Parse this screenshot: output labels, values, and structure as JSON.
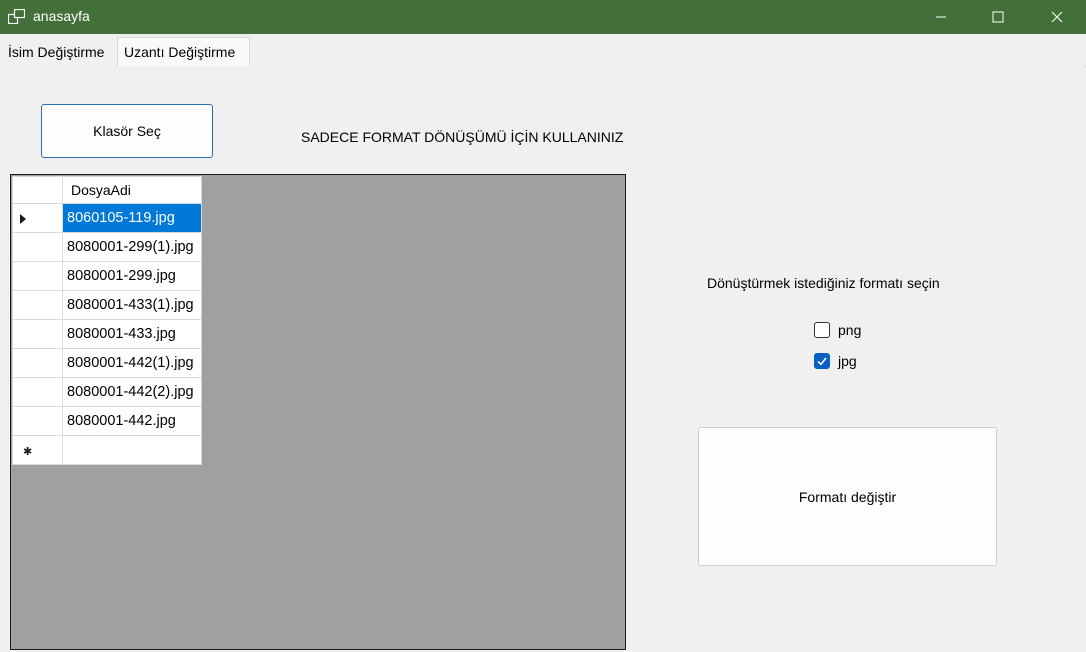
{
  "window": {
    "title": "anasayfa",
    "icon": "app-windows-icon",
    "controls": [
      "minimize-icon",
      "maximize-icon",
      "close-icon"
    ],
    "titlebar_color": "#437039"
  },
  "tabs": [
    {
      "label": "İsim Değiştirme",
      "active": false
    },
    {
      "label": "Uzantı Değiştirme",
      "active": true
    }
  ],
  "main": {
    "folder_button_label": "Klasör Seç",
    "notice": "SADECE FORMAT DÖNÜŞÜMÜ İÇİN KULLANINIZ",
    "grid": {
      "column_header": "DosyaAdi",
      "rows": [
        "8060105-119.jpg",
        "8080001-299(1).jpg",
        "8080001-299.jpg",
        "8080001-433(1).jpg",
        "8080001-433.jpg",
        "8080001-442(1).jpg",
        "8080001-442(2).jpg",
        "8080001-442.jpg"
      ],
      "selected_row": 0,
      "selection_color": "#0078d7"
    },
    "format_prompt": "Dönüştürmek istediğiniz formatı seçin",
    "formats": [
      {
        "label": "png",
        "checked": false
      },
      {
        "label": "jpg",
        "checked": true
      }
    ],
    "convert_button_label": "Formatı değiştir"
  }
}
